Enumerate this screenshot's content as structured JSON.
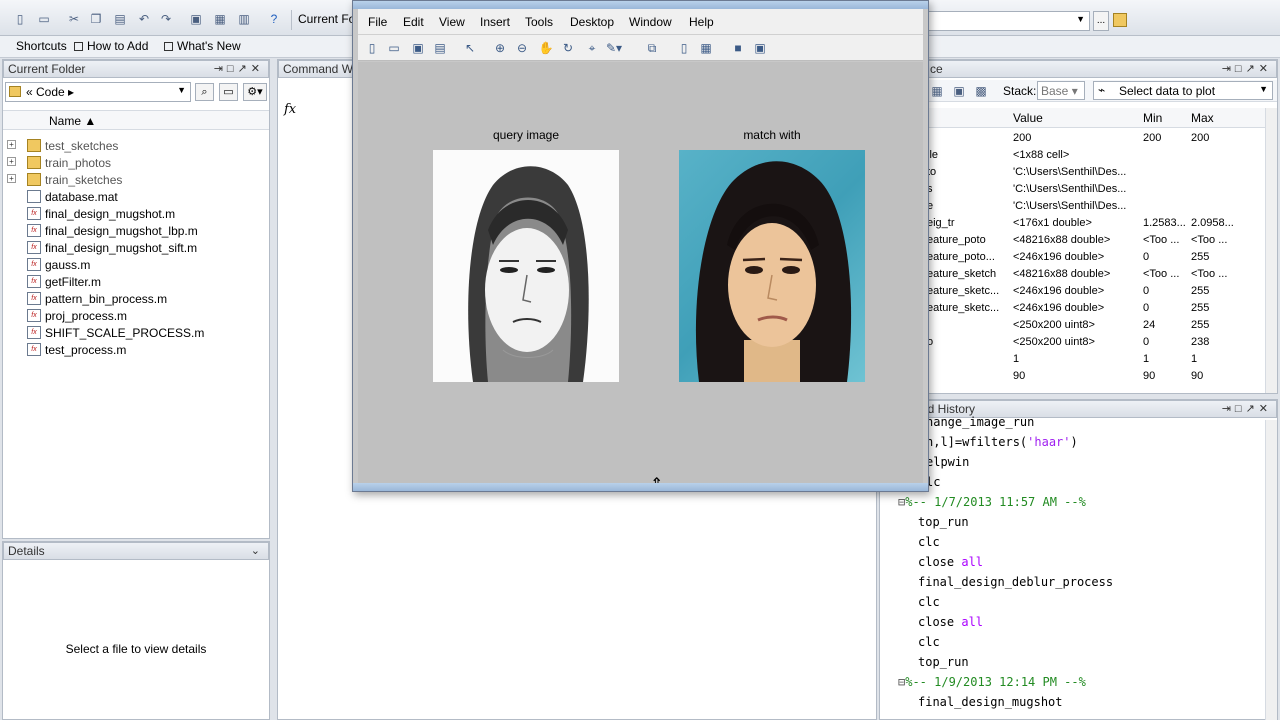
{
  "toolbar": {
    "current_folder_label": "Current Fo",
    "right_path_value": ""
  },
  "shortcuts": {
    "items": [
      "Shortcuts",
      "How to Add",
      "What's New"
    ]
  },
  "current_folder": {
    "title": "Current Folder",
    "path": "« Code ▸",
    "column_name": "Name ▲",
    "files": [
      {
        "name": "test_sketches",
        "type": "folder"
      },
      {
        "name": "train_photos",
        "type": "folder"
      },
      {
        "name": "train_sketches",
        "type": "folder"
      },
      {
        "name": "database.mat",
        "type": "mat"
      },
      {
        "name": "final_design_mugshot.m",
        "type": "m"
      },
      {
        "name": "final_design_mugshot_lbp.m",
        "type": "m"
      },
      {
        "name": "final_design_mugshot_sift.m",
        "type": "m"
      },
      {
        "name": "gauss.m",
        "type": "m"
      },
      {
        "name": "getFilter.m",
        "type": "m"
      },
      {
        "name": "pattern_bin_process.m",
        "type": "m"
      },
      {
        "name": "proj_process.m",
        "type": "m"
      },
      {
        "name": "SHIFT_SCALE_PROCESS.m",
        "type": "m"
      },
      {
        "name": "test_process.m",
        "type": "m"
      }
    ]
  },
  "details": {
    "title": "Details",
    "message": "Select a file to view details"
  },
  "command_window": {
    "title": "Command W",
    "prompt": "fx"
  },
  "workspace": {
    "title": "ce",
    "stack_label": "Stack:",
    "stack_value": "Base",
    "plot_label": "Select data to plot",
    "columns": [
      "Value",
      "Min",
      "Max"
    ],
    "rows": [
      {
        "name": "",
        "value": "200",
        "min": "200",
        "max": "200"
      },
      {
        "name": "ile",
        "value": "<1x88 cell>",
        "min": "",
        "max": ""
      },
      {
        "name": "to",
        "value": "'C:\\Users\\Senthil\\Des...",
        "min": "",
        "max": ""
      },
      {
        "name": "s",
        "value": "'C:\\Users\\Senthil\\Des...",
        "min": "",
        "max": ""
      },
      {
        "name": "e",
        "value": "'C:\\Users\\Senthil\\Des...",
        "min": "",
        "max": ""
      },
      {
        "name": "eig_tr",
        "value": "<176x1 double>",
        "min": "1.2583...",
        "max": "2.0958..."
      },
      {
        "name": "eature_poto",
        "value": "<48216x88 double>",
        "min": "<Too ...",
        "max": "<Too ..."
      },
      {
        "name": "eature_poto...",
        "value": "<246x196 double>",
        "min": "0",
        "max": "255"
      },
      {
        "name": "eature_sketch",
        "value": "<48216x88 double>",
        "min": "<Too ...",
        "max": "<Too ..."
      },
      {
        "name": "eature_sketc...",
        "value": "<246x196 double>",
        "min": "0",
        "max": "255"
      },
      {
        "name": "eature_sketc...",
        "value": "<246x196 double>",
        "min": "0",
        "max": "255"
      },
      {
        "name": "",
        "value": "<250x200 uint8>",
        "min": "24",
        "max": "255"
      },
      {
        "name": "o",
        "value": "<250x200 uint8>",
        "min": "0",
        "max": "238"
      },
      {
        "name": "",
        "value": "1",
        "min": "1",
        "max": "1"
      },
      {
        "name": "",
        "value": "90",
        "min": "90",
        "max": "90"
      }
    ]
  },
  "history": {
    "title": "nd History",
    "lines": [
      {
        "text": "hange_image_run",
        "kind": "cmd",
        "indent": 0
      },
      {
        "text": "h,l]=wfilters('haar')",
        "kind": "cmd",
        "indent": 0
      },
      {
        "text": "elpwin",
        "kind": "cmd",
        "indent": 0
      },
      {
        "text": "lc",
        "kind": "cmd",
        "indent": 0
      },
      {
        "text": "%-- 1/7/2013 11:57 AM --%",
        "kind": "session",
        "indent": 1
      },
      {
        "text": "top_run",
        "kind": "cmd",
        "indent": 2
      },
      {
        "text": "clc",
        "kind": "cmd",
        "indent": 2
      },
      {
        "text": "close all",
        "kind": "cmd",
        "indent": 2
      },
      {
        "text": "final_design_deblur_process",
        "kind": "cmd",
        "indent": 2
      },
      {
        "text": "clc",
        "kind": "cmd",
        "indent": 2
      },
      {
        "text": "close all",
        "kind": "cmd",
        "indent": 2
      },
      {
        "text": "clc",
        "kind": "cmd",
        "indent": 2
      },
      {
        "text": "top_run",
        "kind": "cmd",
        "indent": 2
      },
      {
        "text": "%-- 1/9/2013 12:14 PM --%",
        "kind": "session",
        "indent": 1
      },
      {
        "text": "final_design_mugshot",
        "kind": "cmd",
        "indent": 2
      }
    ]
  },
  "figure": {
    "menus": [
      "File",
      "Edit",
      "View",
      "Insert",
      "Tools",
      "Desktop",
      "Window",
      "Help"
    ],
    "left_title": "query image",
    "right_title": "match with"
  }
}
